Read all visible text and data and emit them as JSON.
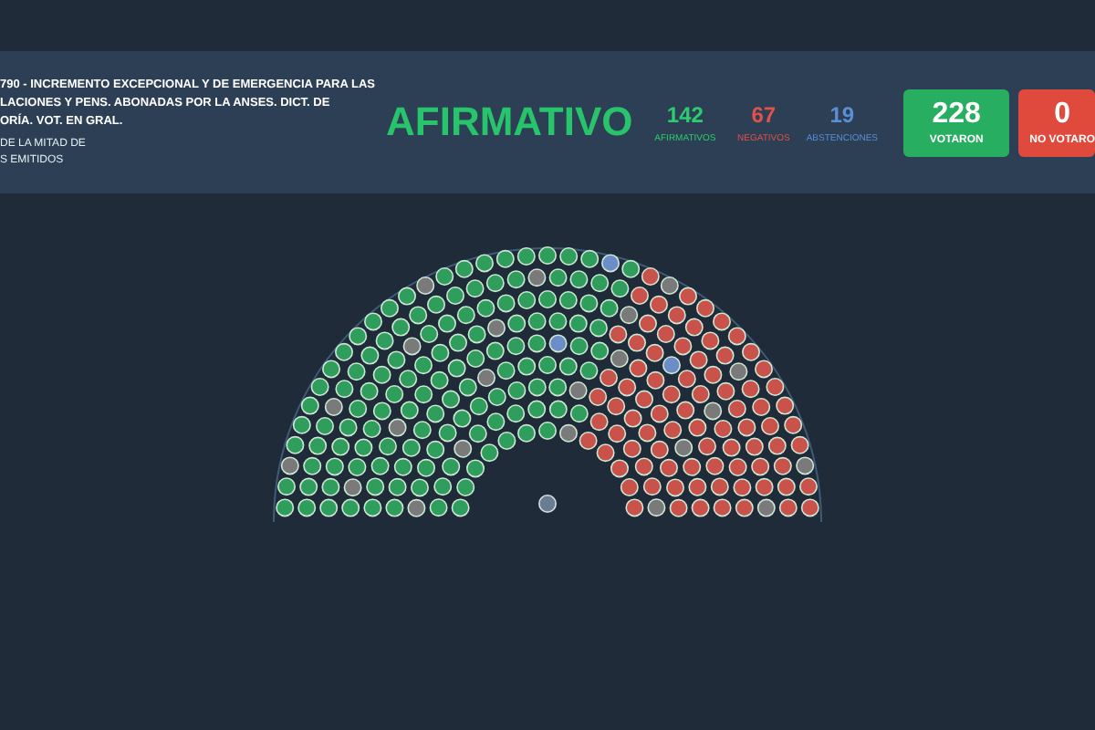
{
  "header": {
    "title_lines": [
      "790 - INCREMENTO EXCEPCIONAL Y DE EMERGENCIA PARA LAS",
      "LACIONES Y PENS. ABONADAS POR LA ANSES. DICT. DE",
      "ORÍA. VOT. EN GRAL."
    ],
    "subtitle_lines": [
      "DE LA MITAD DE",
      "S EMITIDOS"
    ],
    "result": "AFIRMATIVO",
    "counts": [
      {
        "kind": "yes",
        "value": "142",
        "label": "AFIRMATIVOS"
      },
      {
        "kind": "no",
        "value": "67",
        "label": "NEGATIVOS"
      },
      {
        "kind": "abstain",
        "value": "19",
        "label": "ABSTENCIONES"
      }
    ],
    "totals": [
      {
        "kind": "voted",
        "value": "228",
        "label": "VOTARON"
      },
      {
        "kind": "absent",
        "value": "0",
        "label": "NO VOTARO"
      }
    ]
  }
}
